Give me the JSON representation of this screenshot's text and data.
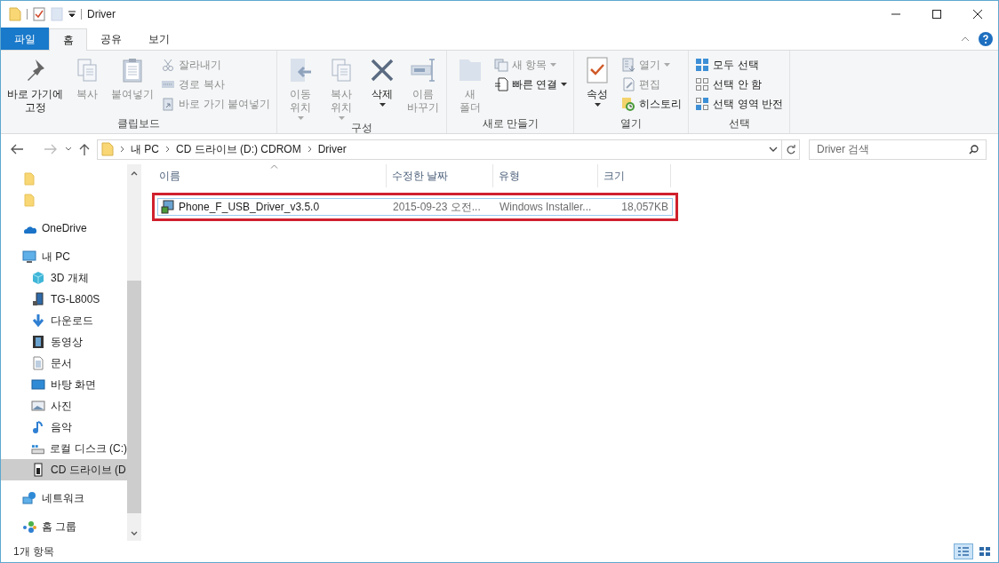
{
  "window": {
    "title": "Driver"
  },
  "ribbon_tabs": [
    {
      "label": "파일",
      "kind": "file",
      "selected": false
    },
    {
      "label": "홈",
      "kind": "tab",
      "selected": true
    },
    {
      "label": "공유",
      "kind": "tab",
      "selected": false
    },
    {
      "label": "보기",
      "kind": "tab",
      "selected": false
    }
  ],
  "ribbon_groups": [
    {
      "label": "클립보드",
      "items": [
        {
          "kind": "large",
          "label": "바로 가기에\n고정",
          "disabled": false,
          "dropdown": false
        },
        {
          "kind": "large",
          "label": "복사",
          "disabled": true,
          "dropdown": false
        },
        {
          "kind": "large",
          "label": "붙여넣기",
          "disabled": true,
          "dropdown": false
        },
        {
          "kind": "stack",
          "items": [
            {
              "label": "잘라내기",
              "disabled": true,
              "dropdown": false
            },
            {
              "label": "경로 복사",
              "disabled": true,
              "dropdown": false
            },
            {
              "label": "바로 가기 붙여넣기",
              "disabled": true,
              "dropdown": false
            }
          ]
        }
      ]
    },
    {
      "label": "구성",
      "items": [
        {
          "kind": "large",
          "label": "이동\n위치",
          "disabled": true,
          "dropdown": true
        },
        {
          "kind": "large",
          "label": "복사\n위치",
          "disabled": true,
          "dropdown": true
        },
        {
          "kind": "large",
          "label": "삭제",
          "disabled": false,
          "dropdown": true
        },
        {
          "kind": "large",
          "label": "이름\n바꾸기",
          "disabled": true,
          "dropdown": false
        }
      ]
    },
    {
      "label": "새로 만들기",
      "items": [
        {
          "kind": "large",
          "label": "새\n폴더",
          "disabled": true,
          "dropdown": false
        },
        {
          "kind": "stack",
          "items": [
            {
              "label": "새 항목",
              "disabled": true,
              "dropdown": true
            },
            {
              "label": "빠른 연결",
              "disabled": false,
              "dropdown": true
            }
          ]
        }
      ]
    },
    {
      "label": "열기",
      "items": [
        {
          "kind": "large",
          "label": "속성",
          "disabled": false,
          "dropdown": true
        },
        {
          "kind": "stack",
          "items": [
            {
              "label": "열기",
              "disabled": true,
              "dropdown": true
            },
            {
              "label": "편집",
              "disabled": true,
              "dropdown": false
            },
            {
              "label": "히스토리",
              "disabled": false,
              "dropdown": false
            }
          ]
        }
      ]
    },
    {
      "label": "선택",
      "items": [
        {
          "kind": "stack",
          "items": [
            {
              "label": "모두 선택",
              "disabled": false,
              "dropdown": false
            },
            {
              "label": "선택 안 함",
              "disabled": false,
              "dropdown": false
            },
            {
              "label": "선택 영역 반전",
              "disabled": false,
              "dropdown": false
            }
          ]
        }
      ]
    }
  ],
  "address_bar": {
    "path": [
      "내 PC",
      "CD 드라이브 (D:) CDROM",
      "Driver"
    ]
  },
  "search": {
    "placeholder": "Driver 검색"
  },
  "nav_pane": [
    {
      "kind": "folder",
      "selected": false
    },
    {
      "kind": "folder",
      "selected": false
    },
    {
      "kind": "onedrive",
      "label": "OneDrive",
      "selected": false
    },
    {
      "kind": "pc",
      "label": "내 PC",
      "selected": false,
      "children": [
        {
          "kind": "cube",
          "label": "3D 개체",
          "selected": false
        },
        {
          "kind": "phone",
          "label": "TG-L800S",
          "selected": false
        },
        {
          "kind": "download",
          "label": "다운로드",
          "selected": false
        },
        {
          "kind": "video",
          "label": "동영상",
          "selected": false
        },
        {
          "kind": "document",
          "label": "문서",
          "selected": false
        },
        {
          "kind": "desktop",
          "label": "바탕 화면",
          "selected": false
        },
        {
          "kind": "picture",
          "label": "사진",
          "selected": false
        },
        {
          "kind": "music",
          "label": "음악",
          "selected": false
        },
        {
          "kind": "disk",
          "label": "로컬 디스크 (C:)",
          "selected": false
        },
        {
          "kind": "cd",
          "label": "CD 드라이브 (D",
          "selected": true
        }
      ]
    },
    {
      "kind": "network",
      "label": "네트워크",
      "selected": false
    },
    {
      "kind": "homegroup",
      "label": "홈 그룹",
      "selected": false
    }
  ],
  "table": {
    "columns": [
      {
        "label": "이름",
        "sorted": true
      },
      {
        "label": "수정한 날짜",
        "sorted": false
      },
      {
        "label": "유형",
        "sorted": false
      },
      {
        "label": "크기",
        "sorted": false
      }
    ],
    "rows": [
      {
        "name": "Phone_F_USB_Driver_v3.5.0",
        "date": "2015-09-23 오전...",
        "type": "Windows Installer...",
        "size": "18,057KB",
        "selected": true,
        "outlined": true
      }
    ]
  },
  "status_bar": {
    "text": "1개 항목",
    "views": [
      {
        "kind": "details",
        "selected": true
      },
      {
        "kind": "icons",
        "selected": false
      }
    ]
  }
}
